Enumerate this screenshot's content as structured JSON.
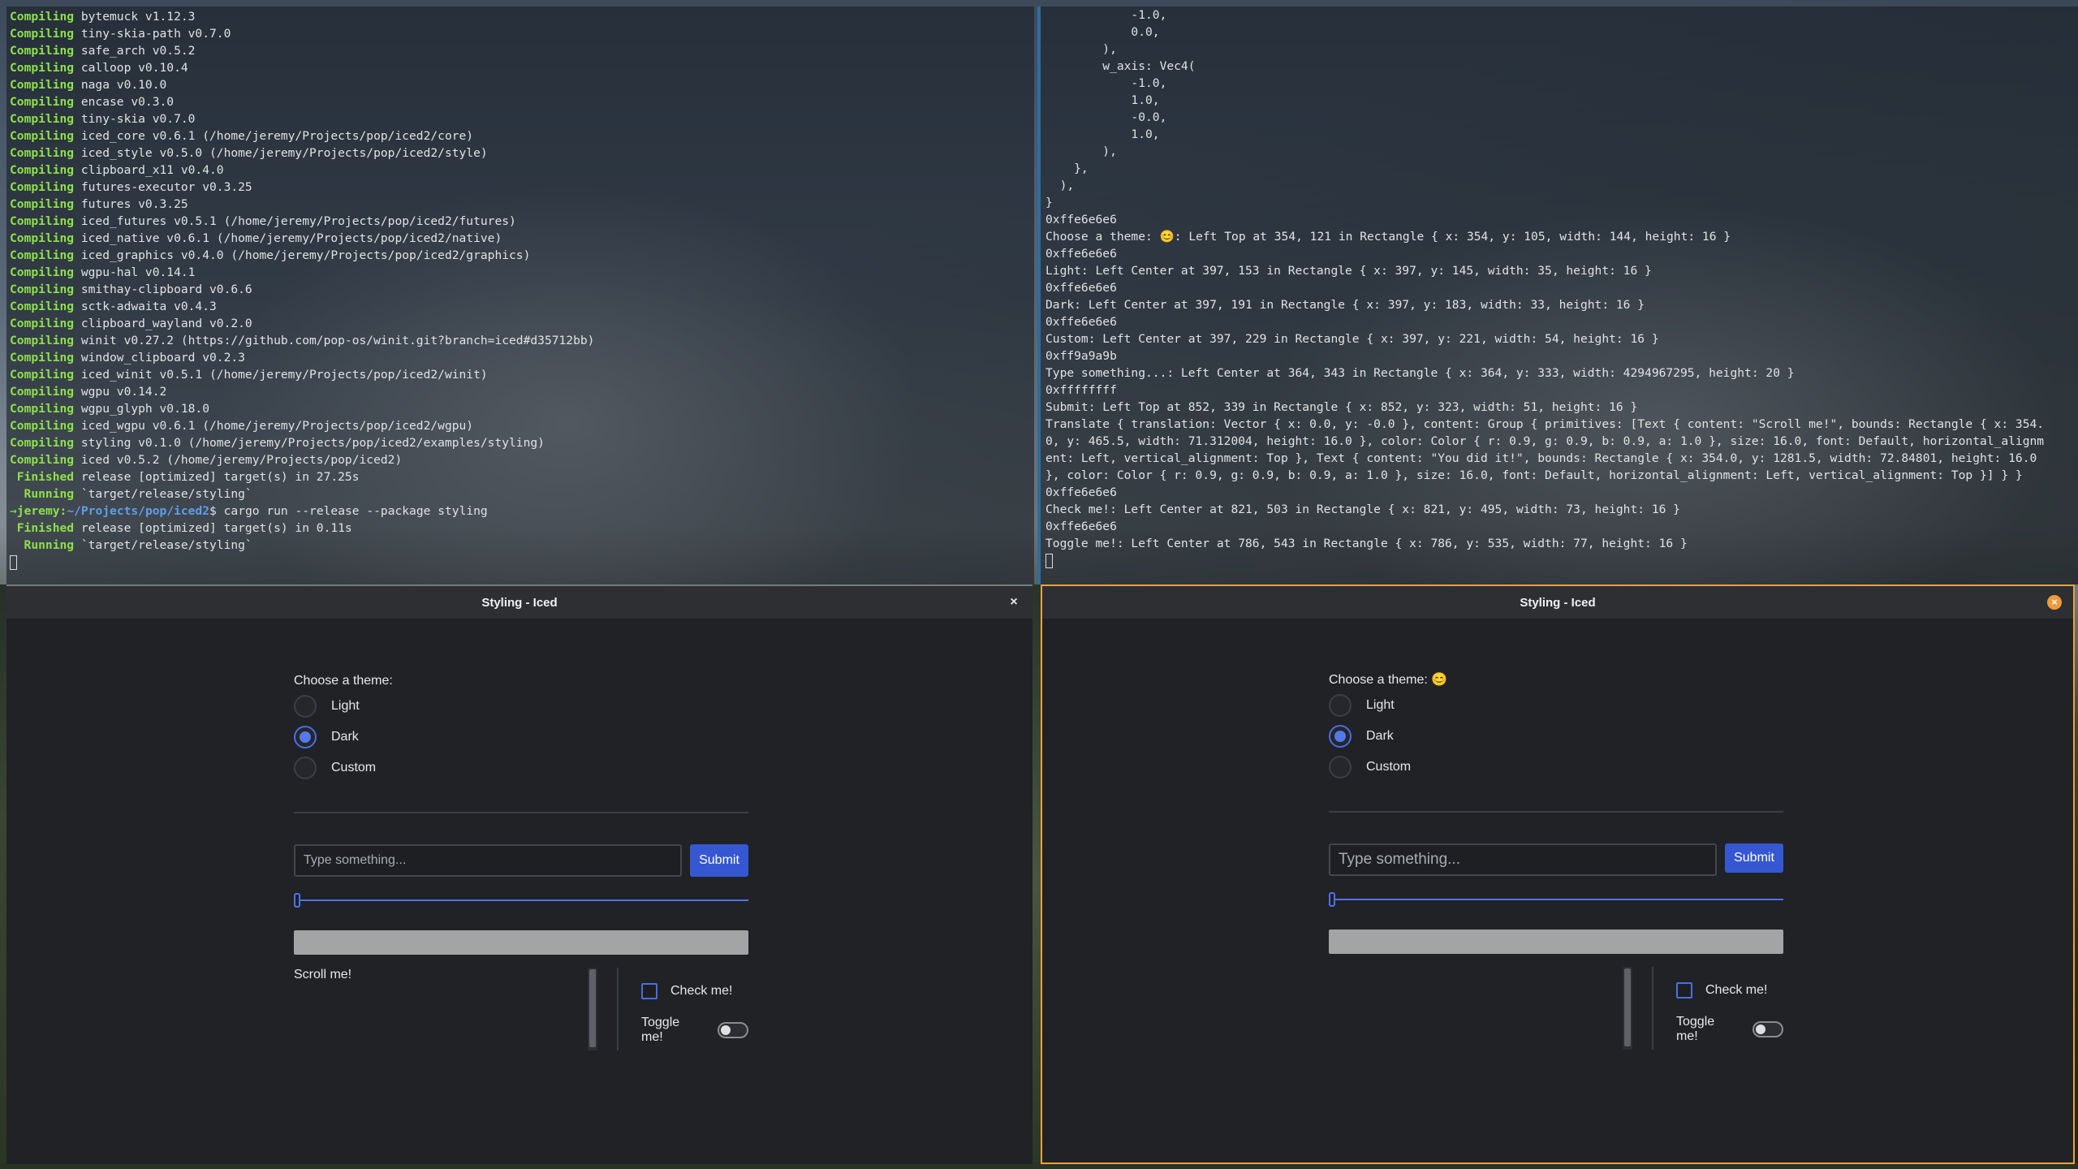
{
  "colors": {
    "accent": "#4a6ee0",
    "button": "#3557d2",
    "active_border": "#e8a33d",
    "terminal_keyword": "#8ee04a",
    "terminal_path": "#5f9ee8"
  },
  "terminal_left": {
    "lines": [
      {
        "kw": "Compiling",
        "text": " bytemuck v1.12.3"
      },
      {
        "kw": "Compiling",
        "text": " tiny-skia-path v0.7.0"
      },
      {
        "kw": "Compiling",
        "text": " safe_arch v0.5.2"
      },
      {
        "kw": "Compiling",
        "text": " calloop v0.10.4"
      },
      {
        "kw": "Compiling",
        "text": " naga v0.10.0"
      },
      {
        "kw": "Compiling",
        "text": " encase v0.3.0"
      },
      {
        "kw": "Compiling",
        "text": " tiny-skia v0.7.0"
      },
      {
        "kw": "Compiling",
        "text": " iced_core v0.6.1 (/home/jeremy/Projects/pop/iced2/core)"
      },
      {
        "kw": "Compiling",
        "text": " iced_style v0.5.0 (/home/jeremy/Projects/pop/iced2/style)"
      },
      {
        "kw": "Compiling",
        "text": " clipboard_x11 v0.4.0"
      },
      {
        "kw": "Compiling",
        "text": " futures-executor v0.3.25"
      },
      {
        "kw": "Compiling",
        "text": " futures v0.3.25"
      },
      {
        "kw": "Compiling",
        "text": " iced_futures v0.5.1 (/home/jeremy/Projects/pop/iced2/futures)"
      },
      {
        "kw": "Compiling",
        "text": " iced_native v0.6.1 (/home/jeremy/Projects/pop/iced2/native)"
      },
      {
        "kw": "Compiling",
        "text": " iced_graphics v0.4.0 (/home/jeremy/Projects/pop/iced2/graphics)"
      },
      {
        "kw": "Compiling",
        "text": " wgpu-hal v0.14.1"
      },
      {
        "kw": "Compiling",
        "text": " smithay-clipboard v0.6.6"
      },
      {
        "kw": "Compiling",
        "text": " sctk-adwaita v0.4.3"
      },
      {
        "kw": "Compiling",
        "text": " clipboard_wayland v0.2.0"
      },
      {
        "kw": "Compiling",
        "text": " winit v0.27.2 (https://github.com/pop-os/winit.git?branch=iced#d35712bb)"
      },
      {
        "kw": "Compiling",
        "text": " window_clipboard v0.2.3"
      },
      {
        "kw": "Compiling",
        "text": " iced_winit v0.5.1 (/home/jeremy/Projects/pop/iced2/winit)"
      },
      {
        "kw": "Compiling",
        "text": " wgpu v0.14.2"
      },
      {
        "kw": "Compiling",
        "text": " wgpu_glyph v0.18.0"
      },
      {
        "kw": "Compiling",
        "text": " iced_wgpu v0.6.1 (/home/jeremy/Projects/pop/iced2/wgpu)"
      },
      {
        "kw": "Compiling",
        "text": " styling v0.1.0 (/home/jeremy/Projects/pop/iced2/examples/styling)"
      },
      {
        "kw": "Compiling",
        "text": " iced v0.5.2 (/home/jeremy/Projects/pop/iced2)"
      },
      {
        "kw": "Finished",
        "text": " release [optimized] target(s) in 27.25s"
      },
      {
        "kw": "Running",
        "text": " `target/release/styling`"
      }
    ],
    "prompt_user": "jeremy:",
    "prompt_path": "~/Projects/pop/iced2",
    "prompt_cmd": "$ cargo run --release --package styling",
    "after": [
      {
        "kw": "Finished",
        "text": " release [optimized] target(s) in 0.11s"
      },
      {
        "kw": "Running",
        "text": " `target/release/styling`"
      }
    ]
  },
  "terminal_right": {
    "lines": [
      "            -1.0,",
      "            0.0,",
      "        ),",
      "        w_axis: Vec4(",
      "            -1.0,",
      "            1.0,",
      "            -0.0,",
      "            1.0,",
      "        ),",
      "    },",
      "  ),",
      "}",
      "0xffe6e6e6",
      "Choose a theme: 😊: Left Top at 354, 121 in Rectangle { x: 354, y: 105, width: 144, height: 16 }",
      "0xffe6e6e6",
      "Light: Left Center at 397, 153 in Rectangle { x: 397, y: 145, width: 35, height: 16 }",
      "0xffe6e6e6",
      "Dark: Left Center at 397, 191 in Rectangle { x: 397, y: 183, width: 33, height: 16 }",
      "0xffe6e6e6",
      "Custom: Left Center at 397, 229 in Rectangle { x: 397, y: 221, width: 54, height: 16 }",
      "0xff9a9a9b",
      "Type something...: Left Center at 364, 343 in Rectangle { x: 364, y: 333, width: 4294967295, height: 20 }",
      "0xffffffff",
      "Submit: Left Top at 852, 339 in Rectangle { x: 852, y: 323, width: 51, height: 16 }",
      "Translate { translation: Vector { x: 0.0, y: -0.0 }, content: Group { primitives: [Text { content: \"Scroll me!\", bounds: Rectangle { x: 354.",
      "0, y: 465.5, width: 71.312004, height: 16.0 }, color: Color { r: 0.9, g: 0.9, b: 0.9, a: 1.0 }, size: 16.0, font: Default, horizontal_alignm",
      "ent: Left, vertical_alignment: Top }, Text { content: \"You did it!\", bounds: Rectangle { x: 354.0, y: 1281.5, width: 72.84801, height: 16.0",
      "}, color: Color { r: 0.9, g: 0.9, b: 0.9, a: 1.0 }, size: 16.0, font: Default, horizontal_alignment: Left, vertical_alignment: Top }] } }",
      "0xffe6e6e6",
      "Check me!: Left Center at 821, 503 in Rectangle { x: 821, y: 495, width: 73, height: 16 }",
      "0xffe6e6e6",
      "Toggle me!: Left Center at 786, 543 in Rectangle { x: 786, y: 535, width: 77, height: 16 }"
    ]
  },
  "windows": [
    {
      "title": "Styling - Iced",
      "close": "×",
      "theme_label": "Choose a theme:",
      "themes": [
        "Light",
        "Dark",
        "Custom"
      ],
      "selected_theme": "Dark",
      "input_placeholder": "Type something...",
      "submit": "Submit",
      "slider_value": 0,
      "progress_value": 0,
      "scroll_text": "Scroll me!",
      "check_label": "Check me!",
      "toggle_label": "Toggle me!"
    },
    {
      "title": "Styling - Iced",
      "close": "×",
      "theme_label": "Choose a theme: 😊",
      "themes": [
        "Light",
        "Dark",
        "Custom"
      ],
      "selected_theme": "Dark",
      "input_placeholder": "Type something...",
      "submit": "Submit",
      "slider_value": 0,
      "progress_value": 0,
      "scroll_text": "",
      "check_label": "Check me!",
      "toggle_label": "Toggle me!"
    }
  ]
}
